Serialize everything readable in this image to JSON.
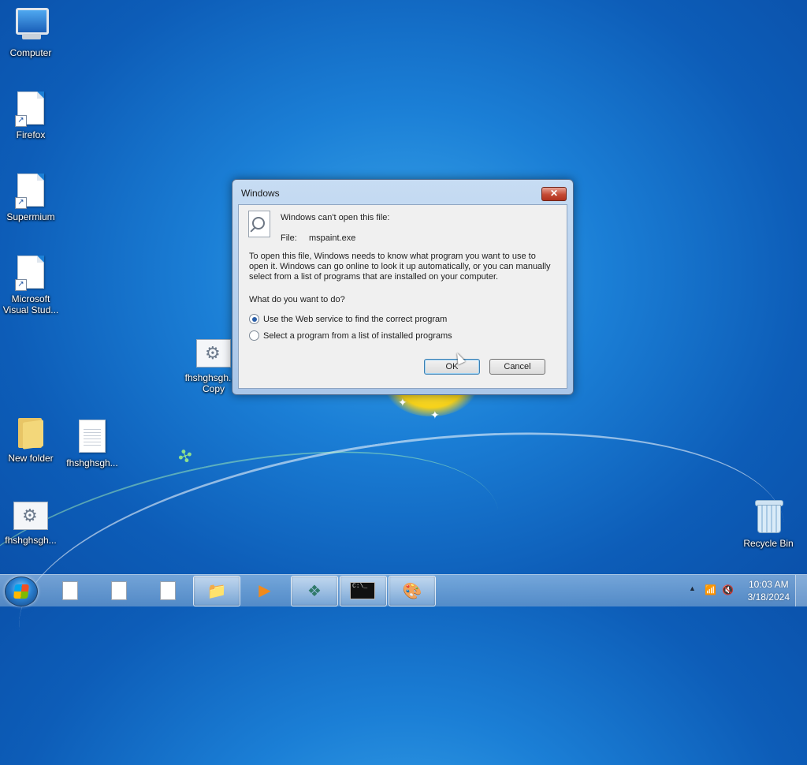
{
  "desktop": {
    "icons": [
      {
        "label": "Computer",
        "icon": "computer-icon"
      },
      {
        "label": "Firefox",
        "icon": "shortcut-file-icon"
      },
      {
        "label": "Supermium",
        "icon": "shortcut-file-icon"
      },
      {
        "label": "Microsoft Visual Stud...",
        "icon": "shortcut-file-icon"
      },
      {
        "label": "fhshghsgh... - Copy",
        "icon": "settings-file-icon"
      },
      {
        "label": "New folder",
        "icon": "folder-icon"
      },
      {
        "label": "fhshghsgh...",
        "icon": "text-file-icon"
      },
      {
        "label": "fhshghsgh...",
        "icon": "settings-file-icon"
      },
      {
        "label": "Recycle Bin",
        "icon": "recycle-bin-icon"
      }
    ]
  },
  "dialog": {
    "title": "Windows",
    "heading": "Windows can't open this file:",
    "file_label": "File:",
    "file_name": "mspaint.exe",
    "body_lines": [
      "To open this file, Windows needs to know what program you want to use to",
      "open it. Windows can go online to look it up automatically, or you can manually",
      "select from a list of programs that are installed on your computer."
    ],
    "question": "What do you want to do?",
    "options": [
      {
        "label": "Use the Web service to find the correct program",
        "selected": true
      },
      {
        "label": "Select a program from a list of installed programs",
        "selected": false
      }
    ],
    "ok_label": "OK",
    "cancel_label": "Cancel",
    "close_glyph": "✕"
  },
  "taskbar": {
    "buttons": [
      {
        "icon": "blank-document-icon"
      },
      {
        "icon": "blank-document-icon"
      },
      {
        "icon": "blank-document-icon"
      },
      {
        "icon": "file-explorer-icon"
      },
      {
        "icon": "media-player-icon"
      },
      {
        "icon": "installer-icon"
      },
      {
        "icon": "command-prompt-icon",
        "text": "C:\\_"
      },
      {
        "icon": "paint-icon"
      }
    ],
    "clock": {
      "time": "10:03 AM",
      "date": "3/18/2024"
    }
  },
  "colors": {
    "accent": "#3c7fb1",
    "close": "#c44a33",
    "desktop": "#1b7fd6"
  }
}
